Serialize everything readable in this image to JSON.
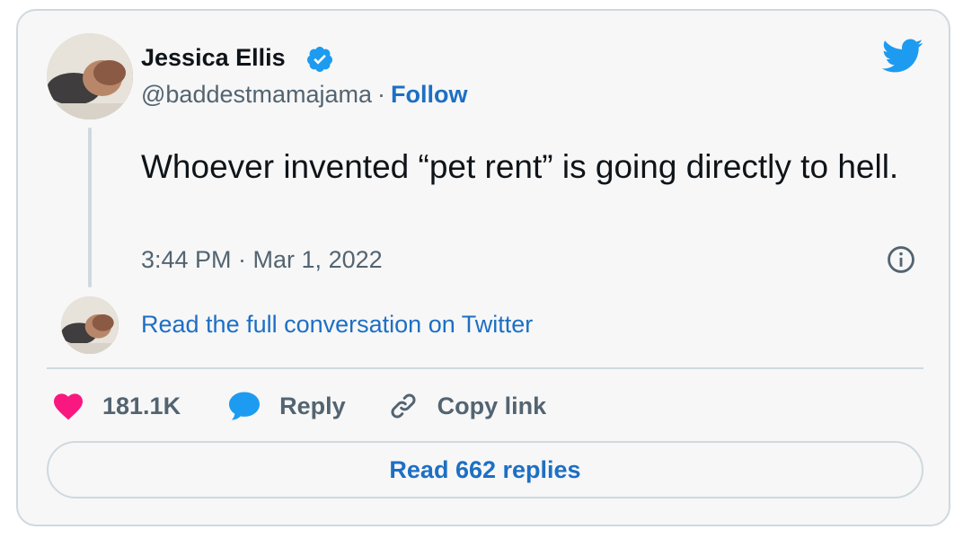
{
  "author": {
    "name": "Jessica Ellis",
    "handle": "@baddestmamajama",
    "separator": "·",
    "follow_label": "Follow"
  },
  "tweet": {
    "text": "Whoever invented “pet rent” is going directly to hell.",
    "timestamp": "3:44 PM · Mar 1, 2022"
  },
  "conversation_link": "Read the full conversation on Twitter",
  "actions": {
    "like_count": "181.1K",
    "reply_label": "Reply",
    "copy_link_label": "Copy link"
  },
  "replies_button": "Read 662 replies",
  "icons": {
    "brand": "twitter-bird-icon",
    "verified": "verified-badge-icon",
    "info": "info-icon",
    "like": "heart-icon",
    "reply": "speech-bubble-icon",
    "copy": "link-icon"
  },
  "colors": {
    "link_blue": "#1d6fc4",
    "twitter_blue": "#1d9bf0",
    "like_pink": "#f91880",
    "text_primary": "#0f1419",
    "text_secondary": "#536471",
    "border": "#cfd9de",
    "card_background": "#f7f7f7"
  }
}
